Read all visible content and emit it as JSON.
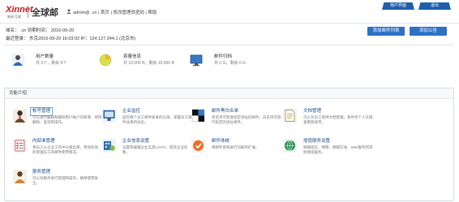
{
  "header": {
    "brand": "Xinnet",
    "brand_sub": "新网  互联",
    "product": "全球邮",
    "user_line": "admin@                  .cn  |  首页  |  修改管理员密码  |  帮助",
    "nav_buttons": [
      "用户界面",
      "退出"
    ]
  },
  "account": {
    "domain_line": "域名：                    .cn  到期时间：  2016-09-20",
    "login_line": "最近登录：  东京2016-09-20 16:03:02   IP：124.127.244.1 (北京市)"
  },
  "actions": {
    "add_mail": "添加邮件列表",
    "add_notice": "添加公告"
  },
  "stats": [
    {
      "label": "用户数量",
      "value": "共 5个，剩余 5个",
      "icon": "users-icon"
    },
    {
      "label": "容量信息",
      "value": "共 10,000 B，剩余 10,000 B",
      "icon": "storage-pie-icon"
    },
    {
      "label": "邮件归档",
      "value": "共 0 G，剩余 0 G",
      "icon": "archive-monitor-icon"
    }
  ],
  "features": {
    "title": "功能介绍",
    "items": [
      {
        "name": "帐号管理",
        "desc": "可以进行编辑和删除用户帐户的新增、修改、删除、查询等操作。",
        "icon": "account-manage-icon"
      },
      {
        "name": "企业监控",
        "desc": "监控每个员工邮件收发的记录，掌握员工邮件往来的动态。",
        "icon": "monitor-icon"
      },
      {
        "name": "邮件黑白名单",
        "desc": "黑名单可拒收指定地址的邮件，白名单可放行指定的地址邮件。",
        "icon": "blackwhite-list-icon"
      },
      {
        "name": "文档管理",
        "desc": "可以为员工提供文档管理，将共享个人云盘、查看目录等。",
        "icon": "document-icon"
      },
      {
        "name": "内部准管理",
        "desc": "将员工从企业工作中分离出来，更加有效的管理员工的邮件使用情况。",
        "icon": "internal-list-icon"
      },
      {
        "name": "企业信息设置",
        "desc": "设置和编辑企业信息LOGO，提高企业形象。",
        "icon": "enterprise-info-icon"
      },
      {
        "name": "邮件体统",
        "desc": "将邮件系统进行功能的扩展。",
        "icon": "mail-system-icon"
      },
      {
        "name": "增值服务设置",
        "desc": "邮箱短信、网络、邮箱在线、Web服务和其他增值服务。",
        "icon": "value-service-icon"
      },
      {
        "name": "服务管理",
        "desc": "可以对服务进行管理和操作，确保使用安全。",
        "icon": "service-manage-icon"
      }
    ]
  },
  "colors": {
    "brand_red": "#c8161d",
    "nav_blue": "#1f5fa8",
    "button_blue": "#2b71c4",
    "link_blue": "#1a4a86",
    "highlight": "#4fb8d6"
  }
}
